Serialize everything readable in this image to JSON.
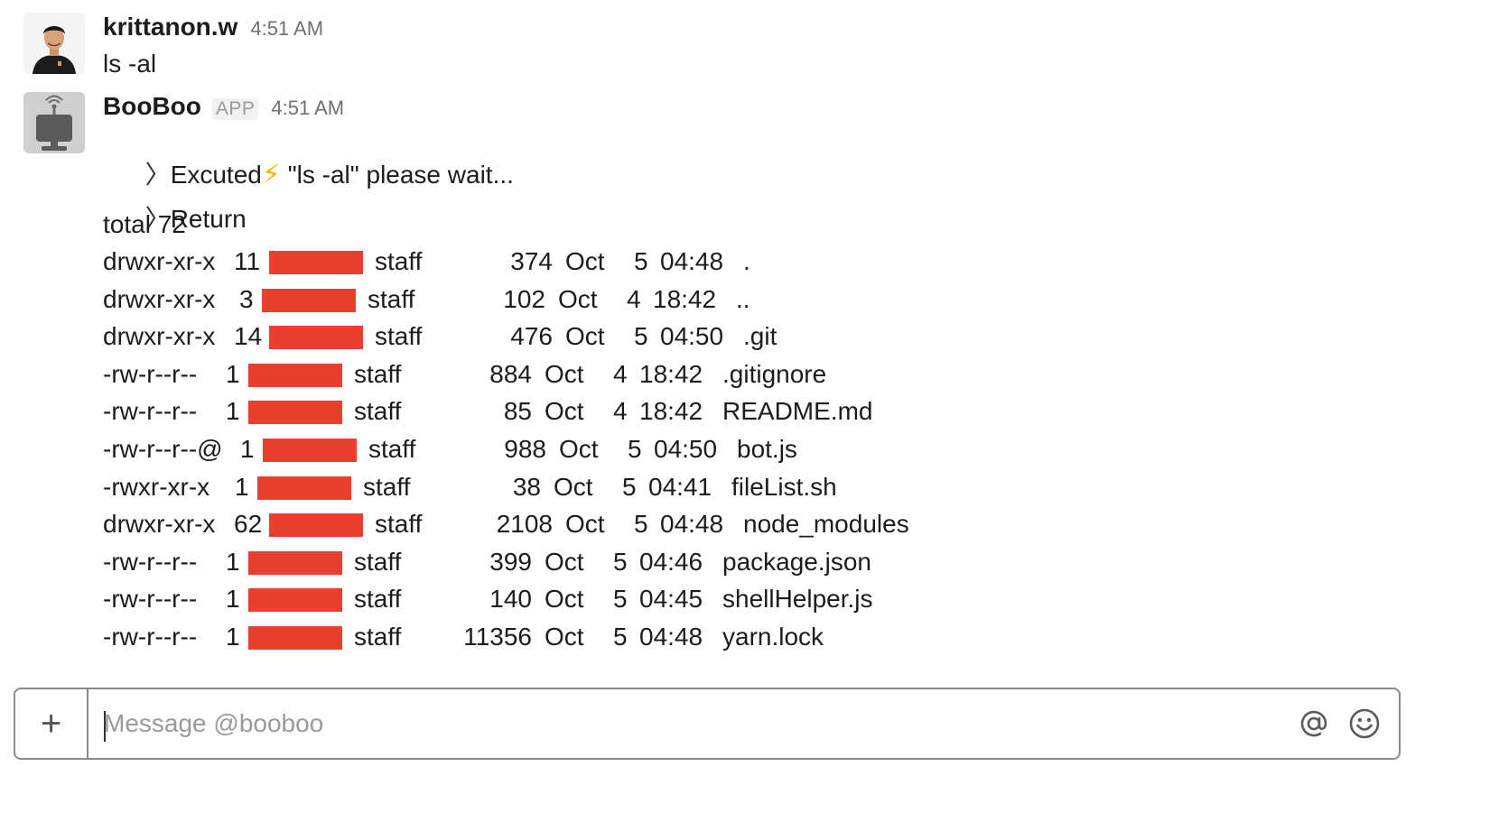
{
  "messages": [
    {
      "author": "krittanon.w",
      "time": "4:51 AM",
      "text": "ls -al"
    },
    {
      "author": "BooBoo",
      "badge": "APP",
      "time": "4:51 AM",
      "executed": {
        "chevron": "〉",
        "pre": "Excuted",
        "icon": "⚡",
        "post": "\"ls -al\" please wait..."
      },
      "return_label": {
        "chevron": "〉",
        "text": "Return"
      },
      "total": "total 72",
      "listing": [
        {
          "perm": "drwxr-xr-x",
          "links": "11",
          "group": "staff",
          "size": "374",
          "month": "Oct",
          "day": "5",
          "time": "04:48",
          "name": "."
        },
        {
          "perm": "drwxr-xr-x",
          "links": "3",
          "group": "staff",
          "size": "102",
          "month": "Oct",
          "day": "4",
          "time": "18:42",
          "name": ".."
        },
        {
          "perm": "drwxr-xr-x",
          "links": "14",
          "group": "staff",
          "size": "476",
          "month": "Oct",
          "day": "5",
          "time": "04:50",
          "name": ".git"
        },
        {
          "perm": "-rw-r--r--",
          "links": "1",
          "group": "staff",
          "size": "884",
          "month": "Oct",
          "day": "4",
          "time": "18:42",
          "name": ".gitignore"
        },
        {
          "perm": "-rw-r--r--",
          "links": "1",
          "group": "staff",
          "size": "85",
          "month": "Oct",
          "day": "4",
          "time": "18:42",
          "name": "README.md"
        },
        {
          "perm": "-rw-r--r--@",
          "links": "1",
          "group": "staff",
          "size": "988",
          "month": "Oct",
          "day": "5",
          "time": "04:50",
          "name": "bot.js"
        },
        {
          "perm": "-rwxr-xr-x",
          "links": "1",
          "group": "staff",
          "size": "38",
          "month": "Oct",
          "day": "5",
          "time": "04:41",
          "name": "fileList.sh"
        },
        {
          "perm": "drwxr-xr-x",
          "links": "62",
          "group": "staff",
          "size": "2108",
          "month": "Oct",
          "day": "5",
          "time": "04:48",
          "name": "node_modules"
        },
        {
          "perm": "-rw-r--r--",
          "links": "1",
          "group": "staff",
          "size": "399",
          "month": "Oct",
          "day": "5",
          "time": "04:46",
          "name": "package.json"
        },
        {
          "perm": "-rw-r--r--",
          "links": "1",
          "group": "staff",
          "size": "140",
          "month": "Oct",
          "day": "5",
          "time": "04:45",
          "name": "shellHelper.js"
        },
        {
          "perm": "-rw-r--r--",
          "links": "1",
          "group": "staff",
          "size": "11356",
          "month": "Oct",
          "day": "5",
          "time": "04:48",
          "name": "yarn.lock"
        }
      ]
    }
  ],
  "composer": {
    "plus_label": "+",
    "placeholder": "Message @booboo",
    "mention_icon": "at-icon",
    "emoji_icon": "smiley-icon"
  },
  "colors": {
    "redaction": "#e8402d",
    "bolt": "#f5b800"
  }
}
